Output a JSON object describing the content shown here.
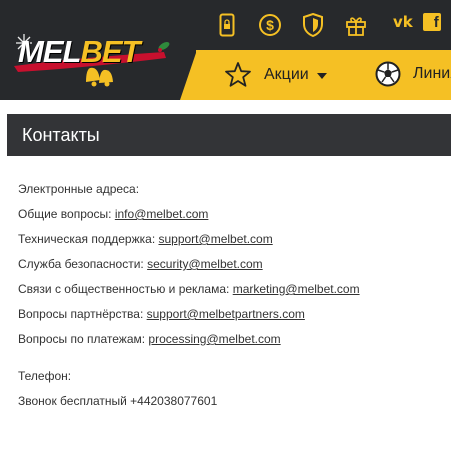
{
  "header": {
    "logo_text_main": "MEL",
    "logo_text_accent": "BET",
    "icons": [
      "mobile-lock-icon",
      "dollar-coin-icon",
      "shield-icon",
      "gift-icon",
      "vk-icon",
      "facebook-icon"
    ],
    "social": {
      "vk": "vk",
      "fb": "f"
    },
    "nav": {
      "promo_label": "Акции",
      "line_label": "Линия"
    }
  },
  "page": {
    "title": "Контакты"
  },
  "contacts": {
    "emails_heading": "Электронные адреса:",
    "rows": [
      {
        "label": "Общие вопросы: ",
        "email": "info@melbet.com"
      },
      {
        "label": "Техническая поддержка: ",
        "email": "support@melbet.com"
      },
      {
        "label": "Служба безопасности: ",
        "email": "security@melbet.com"
      },
      {
        "label": "Связи с общественностью и реклама: ",
        "email": "marketing@melbet.com"
      },
      {
        "label": "Вопросы партнёрства: ",
        "email": "support@melbetpartners.com"
      },
      {
        "label": "Вопросы по платежам: ",
        "email": "processing@melbet.com"
      }
    ],
    "phone_heading": "Телефон:",
    "phone_text": "Звонок бесплатный +442038077601"
  },
  "colors": {
    "accent": "#f5c024",
    "header_bg": "#27292c",
    "title_bg": "#333437"
  }
}
